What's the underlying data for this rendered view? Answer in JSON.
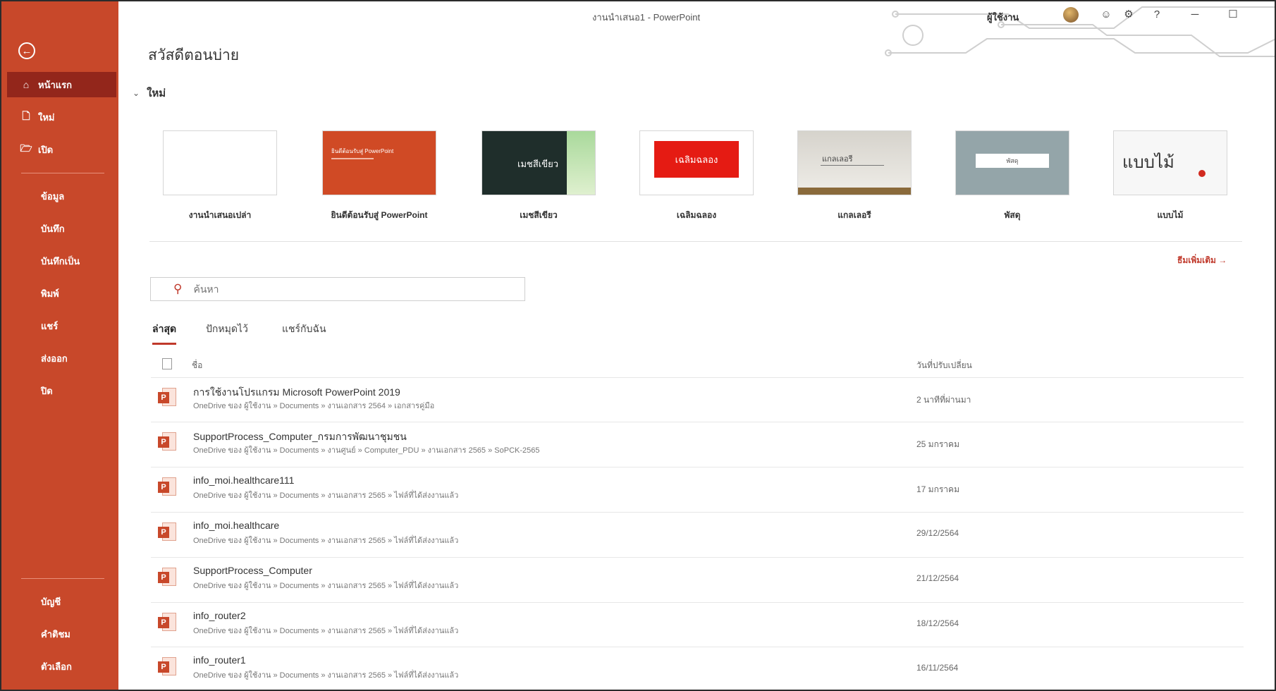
{
  "app": {
    "window_title": "งานนำเสนอ1 - PowerPoint",
    "user": "ผู้ใช้งาน"
  },
  "window_controls": {
    "help": "?",
    "minimize": "─",
    "maximize": "☐"
  },
  "sidebar": {
    "back": "←",
    "items": [
      {
        "label": "หน้าแรก",
        "icon": "⌂"
      },
      {
        "label": "ใหม่",
        "icon": "🗋"
      },
      {
        "label": "เปิด",
        "icon": "🗁"
      }
    ],
    "middle": [
      "ข้อมูล",
      "บันทึก",
      "บันทึกเป็น",
      "พิมพ์",
      "แชร์",
      "ส่งออก",
      "ปิด"
    ],
    "bottom": [
      "บัญชี",
      "คำติชม",
      "ตัวเลือก"
    ]
  },
  "page_title": "สวัสดีตอนบ่าย",
  "new_section": {
    "label": "ใหม่",
    "more_themes": "ธีมเพิ่มเติม →"
  },
  "templates": [
    {
      "label": "งานนำเสนอเปล่า"
    },
    {
      "label": "ยินดีต้อนรับสู่ PowerPoint",
      "thumb_text": "ยินดีต้อนรับสู่ PowerPoint"
    },
    {
      "label": "เมชสีเขียว",
      "thumb_text": "เมชสีเขียว"
    },
    {
      "label": "เฉลิมฉลอง",
      "thumb_text": "เฉลิมฉลอง"
    },
    {
      "label": "แกลเลอรี",
      "thumb_text": "แกลเลอรี"
    },
    {
      "label": "พัสดุ",
      "thumb_text": "พัสดุ"
    },
    {
      "label": "แบบไม้",
      "thumb_text": "แบบไม้"
    }
  ],
  "search": {
    "placeholder": "ค้นหา"
  },
  "tabs": [
    "ล่าสุด",
    "ปักหมุดไว้",
    "แชร์กับฉัน"
  ],
  "list_header": {
    "name": "ชื่อ",
    "date": "วันที่ปรับเปลี่ยน"
  },
  "files": [
    {
      "name": "การใช้งานโปรแกรม Microsoft PowerPoint 2019",
      "path": "OneDrive ของ ผู้ใช้งาน » Documents » งานเอกสาร 2564 » เอกสารคู่มือ",
      "date": "2 นาทีที่ผ่านมา"
    },
    {
      "name": "SupportProcess_Computer_กรมการพัฒนาชุมชน",
      "path": "OneDrive ของ ผู้ใช้งาน » Documents » งานศูนย์ » Computer_PDU » งานเอกสาร 2565 » SoPCK-2565",
      "date": "25 มกราคม"
    },
    {
      "name": "info_moi.healthcare111",
      "path": "OneDrive ของ ผู้ใช้งาน » Documents » งานเอกสาร 2565 » ไฟล์ที่ได้ส่งงานแล้ว",
      "date": "17 มกราคม"
    },
    {
      "name": "info_moi.healthcare",
      "path": "OneDrive ของ ผู้ใช้งาน » Documents » งานเอกสาร 2565 » ไฟล์ที่ได้ส่งงานแล้ว",
      "date": "29/12/2564"
    },
    {
      "name": "SupportProcess_Computer",
      "path": "OneDrive ของ ผู้ใช้งาน » Documents » งานเอกสาร 2565 » ไฟล์ที่ได้ส่งงานแล้ว",
      "date": "21/12/2564"
    },
    {
      "name": "info_router2",
      "path": "OneDrive ของ ผู้ใช้งาน » Documents » งานเอกสาร 2565 » ไฟล์ที่ได้ส่งงานแล้ว",
      "date": "18/12/2564"
    },
    {
      "name": "info_router1",
      "path": "OneDrive ของ ผู้ใช้งาน » Documents » งานเอกสาร 2565 » ไฟล์ที่ได้ส่งงานแล้ว",
      "date": "16/11/2564"
    }
  ],
  "colors": {
    "sidebar": "#c8482a",
    "sidebar_active": "#93261b",
    "accent": "#c0392b"
  }
}
